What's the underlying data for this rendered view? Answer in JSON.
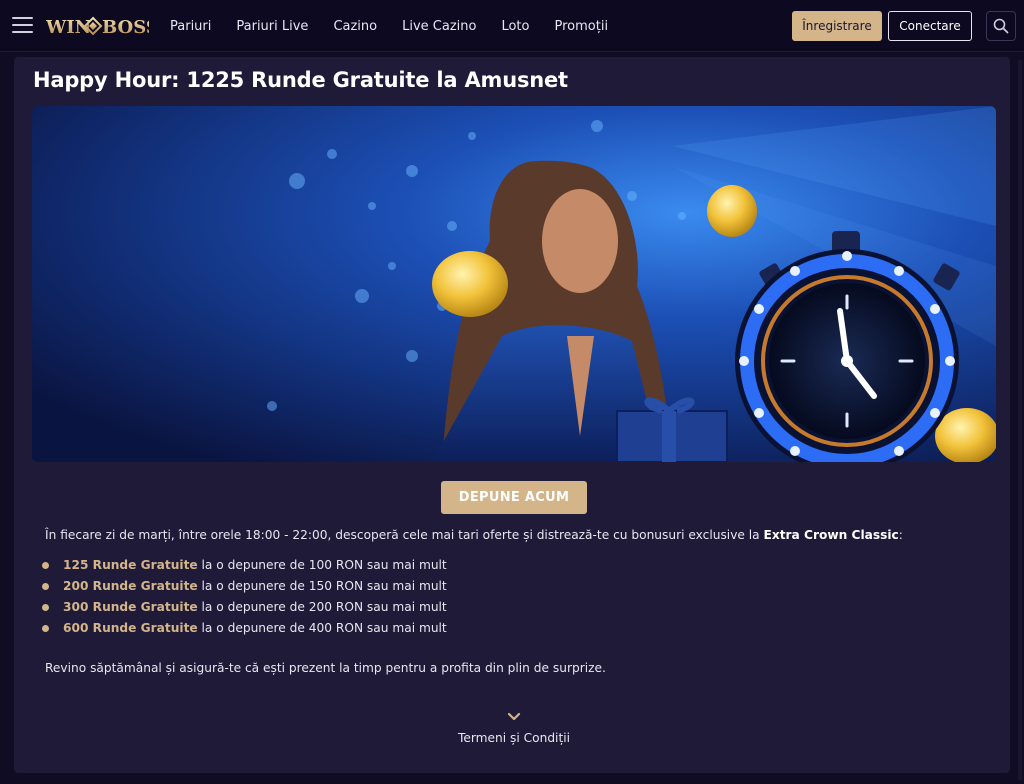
{
  "header": {
    "logo_text_left": "WIN",
    "logo_text_right": "BOSS",
    "nav": [
      "Pariuri",
      "Pariuri Live",
      "Cazino",
      "Live Cazino",
      "Loto",
      "Promoții"
    ],
    "register_label": "Înregistrare",
    "login_label": "Conectare"
  },
  "promo": {
    "title": "Happy Hour: 1225 Runde Gratuite la Amusnet",
    "cta_label": "DEPUNE ACUM",
    "intro_text": "În fiecare zi de marți, între orele 18:00 - 22:00, descoperă cele mai tari oferte și distrează-te cu bonusuri exclusive la",
    "intro_game": "Extra Crown Classic",
    "intro_suffix": ":",
    "offers": [
      {
        "highlight": "125 Runde Gratuite",
        "text": "la o depunere de 100 RON sau mai mult"
      },
      {
        "highlight": "200 Runde Gratuite",
        "text": "la o depunere de 150 RON sau mai mult"
      },
      {
        "highlight": "300 Runde Gratuite",
        "text": "la o depunere de 200 RON sau mai mult"
      },
      {
        "highlight": "600 Runde Gratuite",
        "text": "la o depunere de 400 RON sau mai mult"
      }
    ],
    "outro_text": "Revino săptămânal și asigură-te că ești prezent la timp pentru a profita din plin de surprize.",
    "terms_label": "Termeni și Condiții"
  },
  "colors": {
    "accent_gold": "#d4b58a",
    "page_bg": "#0f0c24",
    "panel_bg": "#1e1a38"
  },
  "icons": [
    "menu-icon",
    "search-icon",
    "chevron-down-icon",
    "bullet-dot-icon"
  ]
}
